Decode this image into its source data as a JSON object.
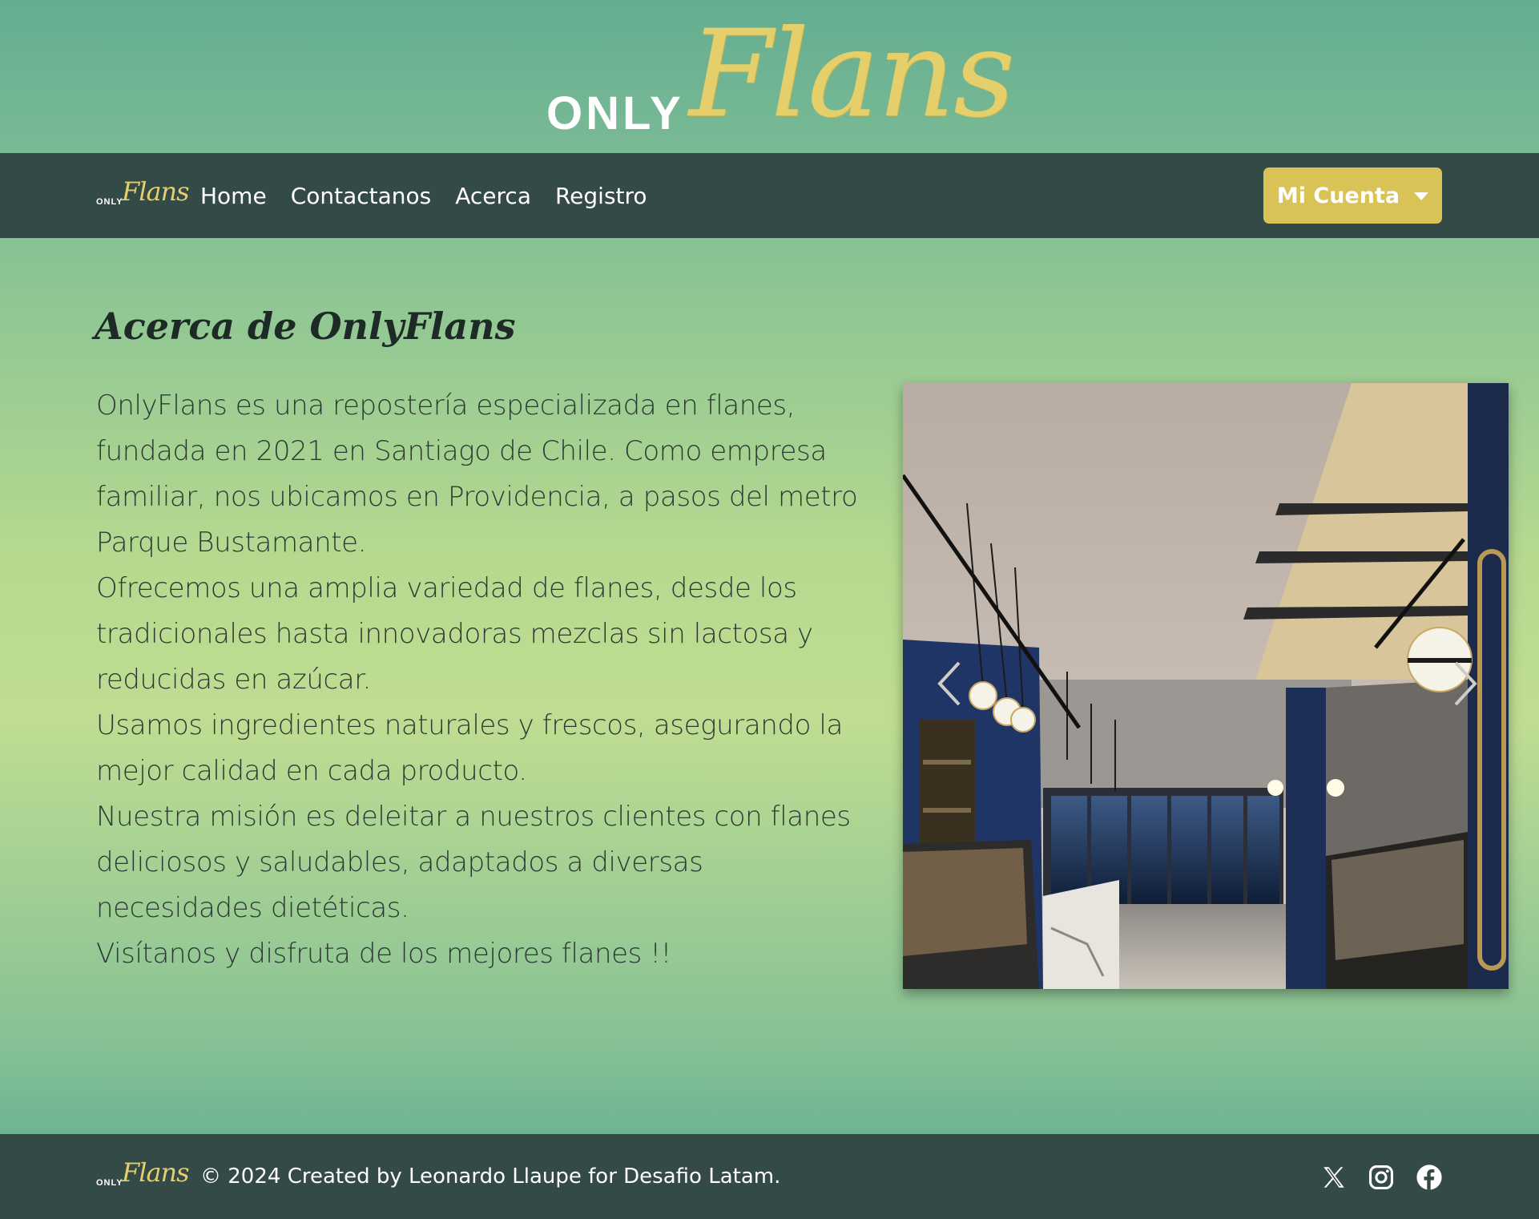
{
  "brand": {
    "logo_small": "ONLY",
    "logo_script": "Flans"
  },
  "nav": {
    "links": [
      "Home",
      "Contactanos",
      "Acerca",
      "Registro"
    ],
    "account_button": "Mi Cuenta"
  },
  "main": {
    "title": "Acerca de OnlyFlans",
    "paragraphs": [
      "OnlyFlans es una repostería especializada en flanes, fundada en 2021 en Santiago de Chile. Como empresa familiar, nos ubicamos en Providencia, a pasos del metro Parque Bustamante.",
      "Ofrecemos una amplia variedad de flanes, desde los tradicionales hasta innovadoras mezclas sin lactosa y reducidas en azúcar.",
      "Usamos ingredientes naturales y frescos, asegurando la mejor calidad en cada producto.",
      "Nuestra misión es deleitar a nuestros clientes con flanes deliciosos y saludables, adaptados a diversas necesidades dietéticas.",
      "Visítanos y disfruta de los mejores flanes !!"
    ]
  },
  "carousel": {
    "prev_icon": "chevron-left-icon",
    "next_icon": "chevron-right-icon"
  },
  "footer": {
    "text": "© 2024 Created by Leonardo Llaupe for Desafio Latam.",
    "social_icons": [
      "x-icon",
      "instagram-icon",
      "facebook-icon"
    ]
  },
  "colors": {
    "nav_bg": "#344a47",
    "accent_gold": "#d9c256",
    "logo_gold": "#e4cf6a",
    "bg_green": "#86c295"
  }
}
